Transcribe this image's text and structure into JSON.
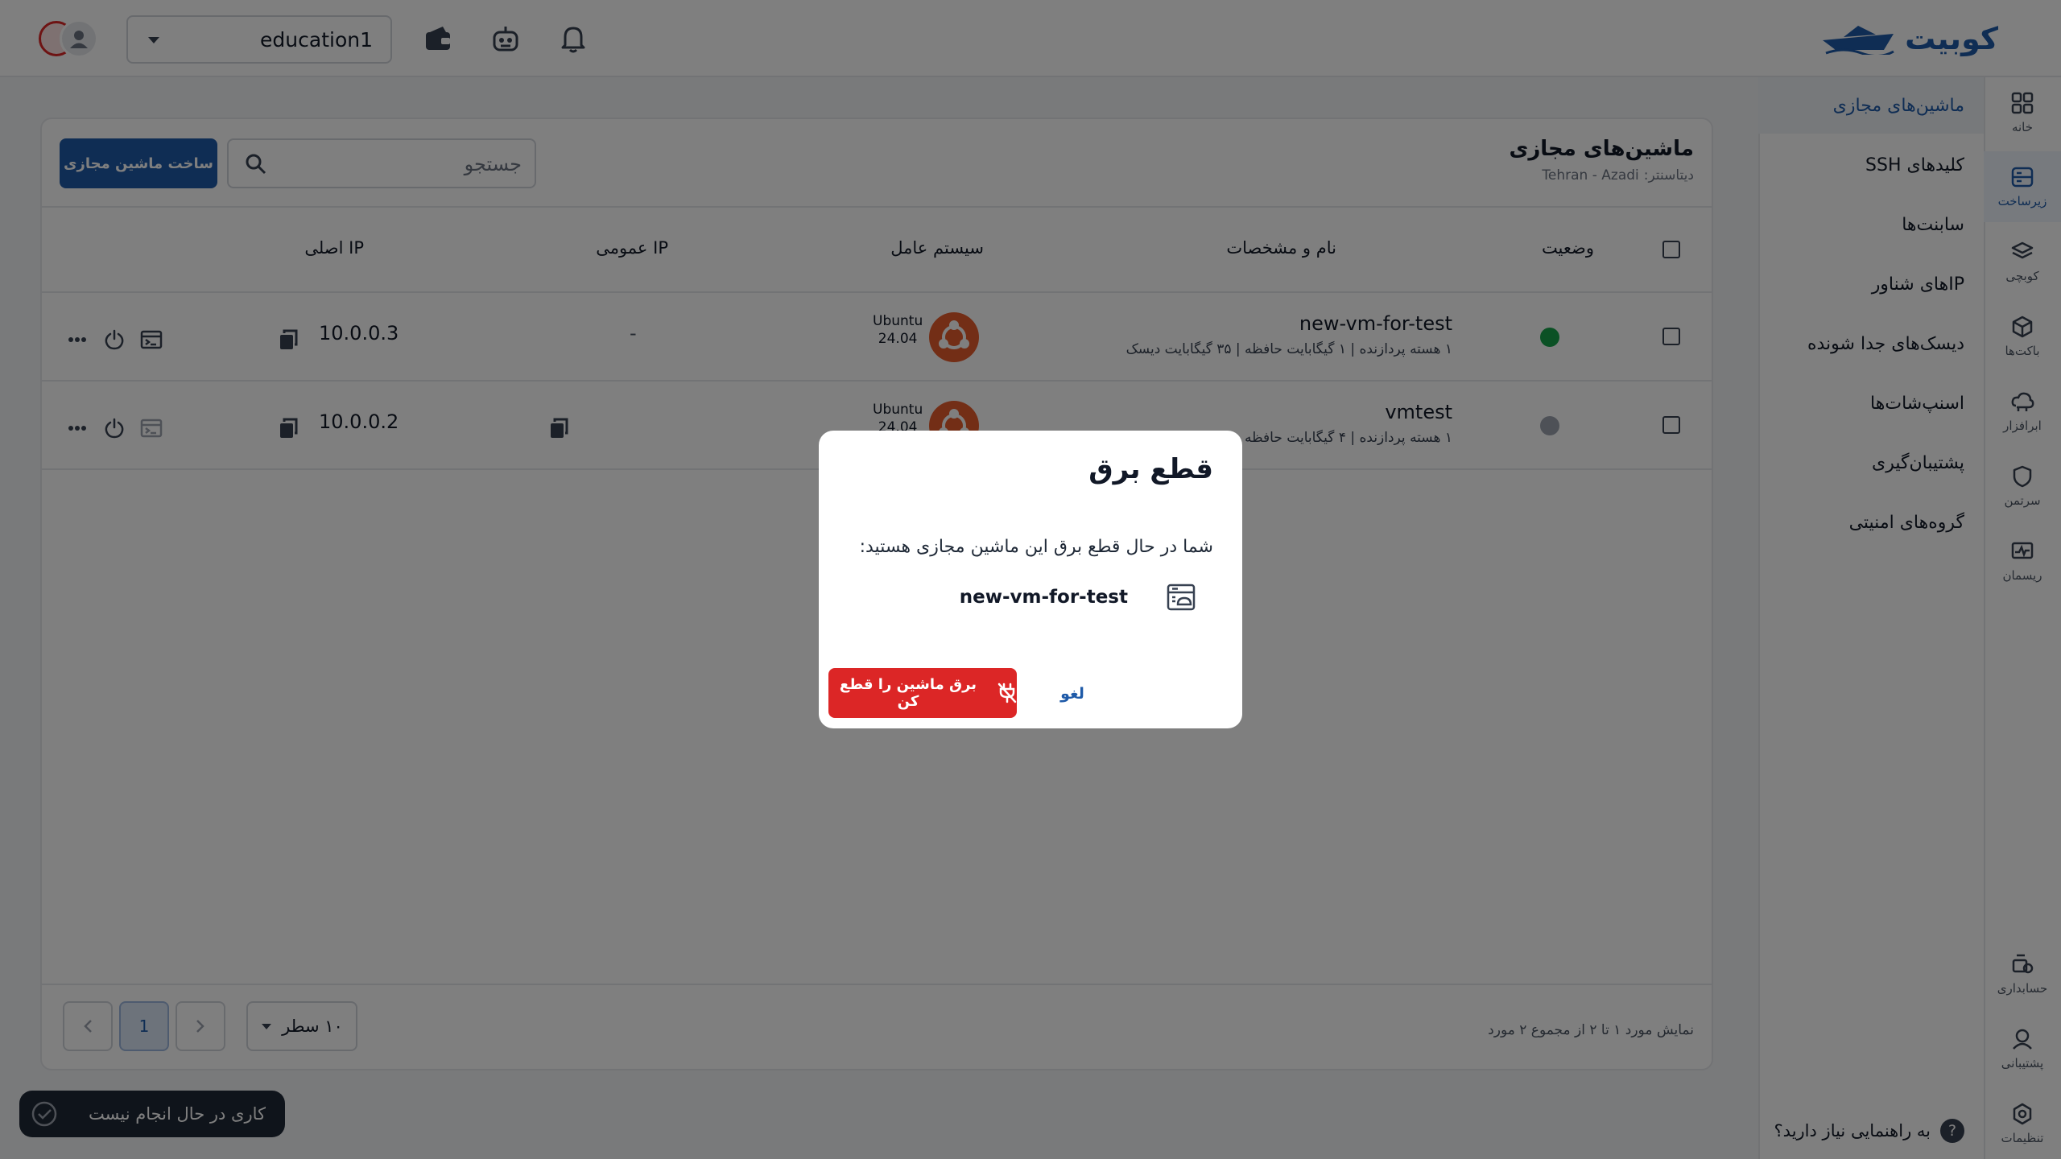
{
  "brand": {
    "name": "کوبیت",
    "color": "#1e5aa8"
  },
  "topbar": {
    "workspace": "education1",
    "icons": [
      "wallet-icon",
      "robot-icon",
      "bell-icon",
      "avatar"
    ]
  },
  "rail": {
    "items": [
      {
        "label": "خانه",
        "icon": "grid-icon"
      },
      {
        "label": "زیرساخت",
        "icon": "server-icon",
        "active": true
      },
      {
        "label": "کوبچی",
        "icon": "layers-icon"
      },
      {
        "label": "باکت‌ها",
        "icon": "cube-icon"
      },
      {
        "label": "ابرافزار",
        "icon": "cloud-icon"
      },
      {
        "label": "سرتمن",
        "icon": "shield-icon"
      },
      {
        "label": "ریسمان",
        "icon": "monitor-icon"
      },
      {
        "label": "حسابداری",
        "icon": "accounting-icon"
      },
      {
        "label": "پشتیبانی",
        "icon": "support-icon"
      },
      {
        "label": "تنظیمات",
        "icon": "settings-icon"
      }
    ]
  },
  "subnav": {
    "items": [
      {
        "label": "ماشین‌های مجازی",
        "active": true
      },
      {
        "label": "کلیدهای SSH"
      },
      {
        "label": "سابنت‌ها"
      },
      {
        "label": "IPهای شناور"
      },
      {
        "label": "دیسک‌های جدا شونده"
      },
      {
        "label": "اسنپ‌شات‌ها"
      },
      {
        "label": "پشتیبان‌گیری"
      },
      {
        "label": "گروه‌های امنیتی"
      }
    ],
    "help": "به راهنمایی نیاز دارید؟"
  },
  "main": {
    "title": "ماشین‌های مجازی",
    "datacenter_label": "دیتاسنتر:",
    "datacenter_value": "Tehran - Azadi",
    "create_button": "ساخت ماشین مجازی",
    "search_placeholder": "جستجو",
    "columns": {
      "status": "وضعیت",
      "name": "نام و مشخصات",
      "os": "سیستم عامل",
      "public_ip": "IP عمومی",
      "private_ip": "IP اصلی"
    },
    "rows": [
      {
        "name": "new-vm-for-test",
        "specs": "۱ هسته پردازنده | ۱ گیگابایت حافظه | ۳۵ گیگابایت دیسک",
        "status_color": "#16a34a",
        "os_name": "Ubuntu",
        "os_version": "24.04",
        "public_ip": "-",
        "private_ip": "10.0.0.3"
      },
      {
        "name": "vmtest",
        "specs": "۱ هسته پردازنده | ۴ گیگابایت حافظه",
        "status_color": "#9ca3af",
        "os_name": "Ubuntu",
        "os_version": "24.04",
        "public_ip": "",
        "private_ip": "10.0.0.2"
      }
    ],
    "pagination": {
      "info": "نمایش مورد ۱ تا ۲ از مجموع ۲ مورد",
      "rows_per_page": "۱۰ سطر",
      "current_page": "1"
    }
  },
  "toast": {
    "text": "کاری در حال انجام نیست"
  },
  "modal": {
    "title": "قطع برق",
    "message": "شما در حال قطع برق این ماشین مجازی هستید:",
    "vm_name": "new-vm-for-test",
    "confirm_button": "برق ماشین را قطع کن",
    "cancel_button": "لغو",
    "danger_color": "#dc2626"
  }
}
